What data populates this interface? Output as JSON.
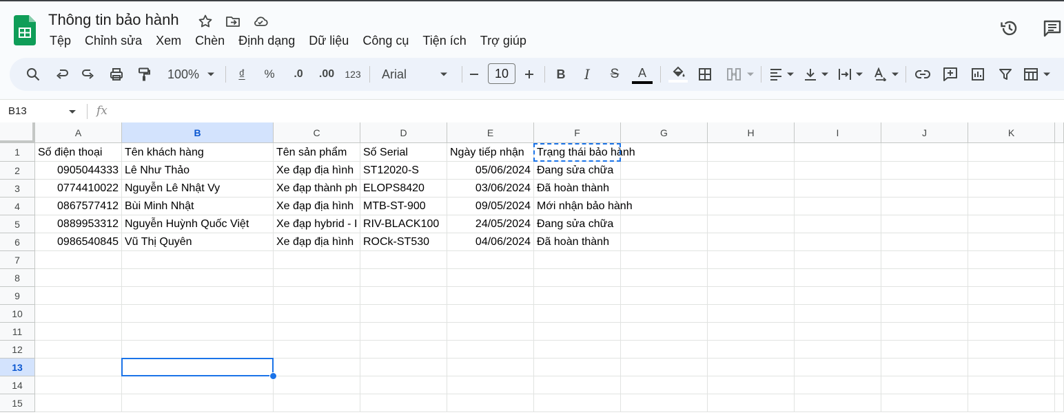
{
  "document": {
    "title": "Thông tin bảo hành",
    "star_icon": "star-icon",
    "move_icon": "move-to-folder-icon",
    "cloud_icon": "cloud-saved-icon"
  },
  "menu": [
    "Tệp",
    "Chỉnh sửa",
    "Xem",
    "Chèn",
    "Định dạng",
    "Dữ liệu",
    "Công cụ",
    "Tiện ích",
    "Trợ giúp"
  ],
  "toolbar": {
    "zoom": "100%",
    "currency": "₫",
    "percent": "%",
    "dec_decrease": ".0",
    "dec_increase": ".00",
    "number_format": "123",
    "font": "Arial",
    "font_size": "10"
  },
  "formula_bar": {
    "name_box": "B13",
    "fx": "fx",
    "value": ""
  },
  "sheet": {
    "columns": [
      "A",
      "B",
      "C",
      "D",
      "E",
      "F",
      "G",
      "H",
      "I",
      "J",
      "K"
    ],
    "selected_column": "B",
    "rows": [
      "1",
      "2",
      "3",
      "4",
      "5",
      "6",
      "7",
      "8",
      "9",
      "10",
      "11",
      "12",
      "13",
      "14",
      "15"
    ],
    "selected_row": "13",
    "selected_cell": "B13",
    "copied_range": "F1",
    "header_row": [
      "Số điện thoại",
      "Tên khách hàng",
      "Tên sản phẩm",
      "Số Serial",
      "Ngày tiếp nhận",
      "Trạng thái bảo hành"
    ],
    "data": [
      [
        "0905044333",
        "Lê Như Thảo",
        "Xe đạp địa hình",
        "ST12020-S",
        "05/06/2024",
        "Đang sửa chữa"
      ],
      [
        "0774410022",
        "Nguyễn Lê Nhật Vy",
        "Xe đạp thành ph",
        "ELOPS8420",
        "03/06/2024",
        "Đã hoàn thành"
      ],
      [
        "0867577412",
        "Bùi Minh Nhật",
        "Xe đạp địa hình",
        "MTB-ST-900",
        "09/05/2024",
        "Mới nhận bảo hành"
      ],
      [
        "0889953312",
        "Nguyễn Huỳnh Quốc Việt",
        "Xe đạp hybrid - I",
        "RIV-BLACK100",
        "24/05/2024",
        "Đang sửa chữa"
      ],
      [
        "0986540845",
        "Vũ Thị Quyên",
        "Xe đạp địa hình",
        "ROCk-ST530",
        "04/06/2024",
        "Đã hoàn thành"
      ]
    ]
  },
  "colors": {
    "accent": "#1a73e8",
    "sheets_green": "#0f9d58",
    "toolbar_bg": "#edf2fa",
    "selected_header_bg": "#d3e3fd"
  }
}
